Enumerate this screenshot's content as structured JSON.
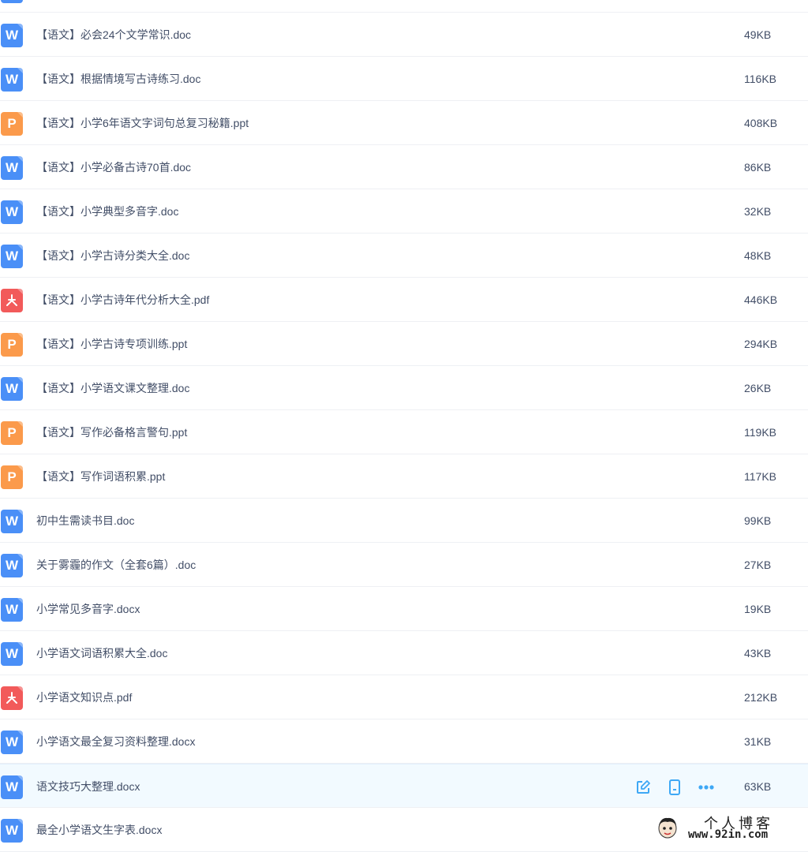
{
  "colors": {
    "doc": "#4a8ff7",
    "ppt": "#fb9a4b",
    "pdf": "#f25a5a",
    "accent": "#3ea8f5"
  },
  "files": [
    {
      "type": "doc",
      "icon_letter": "W",
      "name": "",
      "size": ""
    },
    {
      "type": "doc",
      "icon_letter": "W",
      "name": "【语文】必会24个文学常识.doc",
      "size": "49KB"
    },
    {
      "type": "doc",
      "icon_letter": "W",
      "name": "【语文】根据情境写古诗练习.doc",
      "size": "116KB"
    },
    {
      "type": "ppt",
      "icon_letter": "P",
      "name": "【语文】小学6年语文字词句总复习秘籍.ppt",
      "size": "408KB"
    },
    {
      "type": "doc",
      "icon_letter": "W",
      "name": "【语文】小学必备古诗70首.doc",
      "size": "86KB"
    },
    {
      "type": "doc",
      "icon_letter": "W",
      "name": "【语文】小学典型多音字.doc",
      "size": "32KB"
    },
    {
      "type": "doc",
      "icon_letter": "W",
      "name": "【语文】小学古诗分类大全.doc",
      "size": "48KB"
    },
    {
      "type": "pdf",
      "icon_letter": "",
      "name": "【语文】小学古诗年代分析大全.pdf",
      "size": "446KB"
    },
    {
      "type": "ppt",
      "icon_letter": "P",
      "name": "【语文】小学古诗专项训练.ppt",
      "size": "294KB"
    },
    {
      "type": "doc",
      "icon_letter": "W",
      "name": "【语文】小学语文课文整理.doc",
      "size": "26KB"
    },
    {
      "type": "ppt",
      "icon_letter": "P",
      "name": "【语文】写作必备格言警句.ppt",
      "size": "119KB"
    },
    {
      "type": "ppt",
      "icon_letter": "P",
      "name": "【语文】写作词语积累.ppt",
      "size": "117KB"
    },
    {
      "type": "doc",
      "icon_letter": "W",
      "name": "初中生需读书目.doc",
      "size": "99KB"
    },
    {
      "type": "doc",
      "icon_letter": "W",
      "name": "关于雾霾的作文（全套6篇）.doc",
      "size": "27KB"
    },
    {
      "type": "doc",
      "icon_letter": "W",
      "name": "小学常见多音字.docx",
      "size": "19KB"
    },
    {
      "type": "doc",
      "icon_letter": "W",
      "name": "小学语文词语积累大全.doc",
      "size": "43KB"
    },
    {
      "type": "pdf",
      "icon_letter": "",
      "name": "小学语文知识点.pdf",
      "size": "212KB"
    },
    {
      "type": "doc",
      "icon_letter": "W",
      "name": "小学语文最全复习资料整理.docx",
      "size": "31KB"
    },
    {
      "type": "doc",
      "icon_letter": "W",
      "name": "语文技巧大整理.docx",
      "size": "63KB",
      "hover": true
    },
    {
      "type": "doc",
      "icon_letter": "W",
      "name": "最全小学语文生字表.docx",
      "size": ""
    }
  ],
  "row_actions": [
    {
      "icon": "edit-icon"
    },
    {
      "icon": "mobile-icon"
    },
    {
      "icon": "more-icon"
    }
  ],
  "watermark": {
    "title": "个人博客",
    "url": "www.92in.com"
  }
}
